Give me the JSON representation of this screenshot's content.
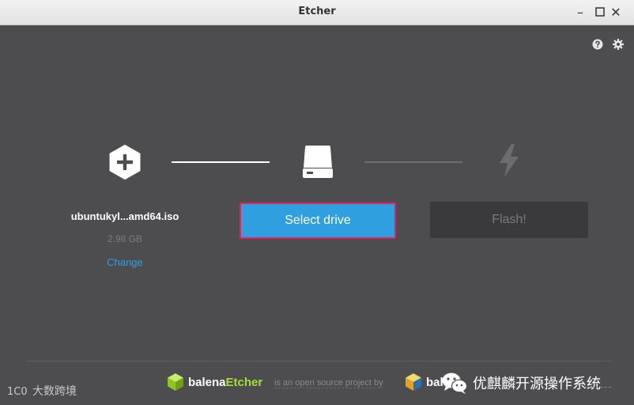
{
  "window": {
    "title": "Etcher",
    "minimize_glyph": "–",
    "close_glyph": "✕"
  },
  "header_icons": [
    "help-icon",
    "gear-icon"
  ],
  "steps": {
    "image": {
      "icon": "plus-hexagon-icon",
      "name": "ubuntukyl...amd64.iso",
      "size": "2.98 GB",
      "change_label": "Change"
    },
    "drive": {
      "icon": "drive-icon",
      "button_label": "Select drive"
    },
    "flash": {
      "icon": "lightning-icon",
      "button_label": "Flash!"
    }
  },
  "footer": {
    "brand_prefix": "balena",
    "brand_suffix": "Etcher",
    "tagline": "is an open source project by",
    "brand2": "bale",
    "watermark": "优麒麟开源操作系统"
  },
  "corner_watermark": {
    "mark": "1C0",
    "text": "大数跨境"
  },
  "colors": {
    "background": "#4d4d50",
    "accent": "#2f9fe0",
    "highlight_border": "#e0245e",
    "brand_green": "#a5de37",
    "disabled_button": "#3a3a3c"
  }
}
